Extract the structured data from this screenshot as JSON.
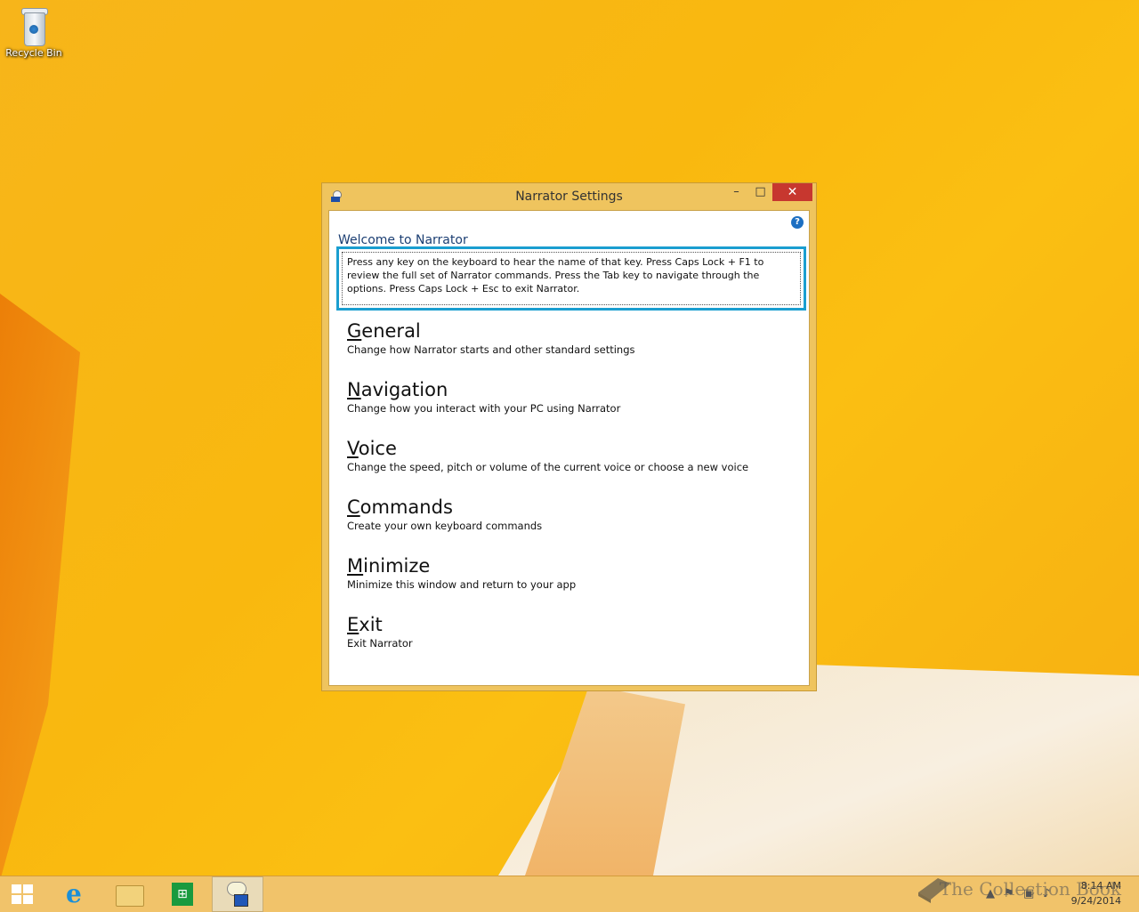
{
  "desktop": {
    "icons": [
      {
        "label": "Recycle Bin",
        "icon": "recycle-bin-icon"
      }
    ]
  },
  "window": {
    "title": "Narrator Settings",
    "controls": {
      "minimize": "–",
      "maximize": "□",
      "close": "✕"
    },
    "help": "?",
    "welcome": "Welcome to Narrator",
    "instructions": "Press any key on the keyboard to hear the name of that key.  Press Caps Lock + F1 to review the full set of Narrator commands.  Press the Tab key to navigate through the options.  Press Caps Lock + Esc to exit Narrator.",
    "items": [
      {
        "key": "G",
        "rest": "eneral",
        "desc": "Change how Narrator starts and other standard settings"
      },
      {
        "key": "N",
        "rest": "avigation",
        "desc": "Change how you interact with your PC using Narrator"
      },
      {
        "key": "V",
        "rest": "oice",
        "desc": "Change the speed, pitch or volume of the current voice or choose a new voice"
      },
      {
        "key": "C",
        "rest": "ommands",
        "desc": "Create your own keyboard commands"
      },
      {
        "key": "M",
        "rest": "inimize",
        "desc": "Minimize this window and return to your app"
      },
      {
        "key": "E",
        "rest": "xit",
        "desc": "Exit Narrator"
      }
    ]
  },
  "taskbar": {
    "buttons": [
      "start-button",
      "internet-explorer",
      "file-explorer",
      "store",
      "narrator"
    ],
    "active": "narrator",
    "store_glyph": "⊞",
    "ie_glyph": "e",
    "clock": {
      "time": "8:14 AM",
      "date": "9/24/2014"
    },
    "watermark": "The Collection Book"
  },
  "colors": {
    "accent_focus": "#1a9ed0",
    "close_button": "#c7372f",
    "window_frame": "#efc45e"
  }
}
